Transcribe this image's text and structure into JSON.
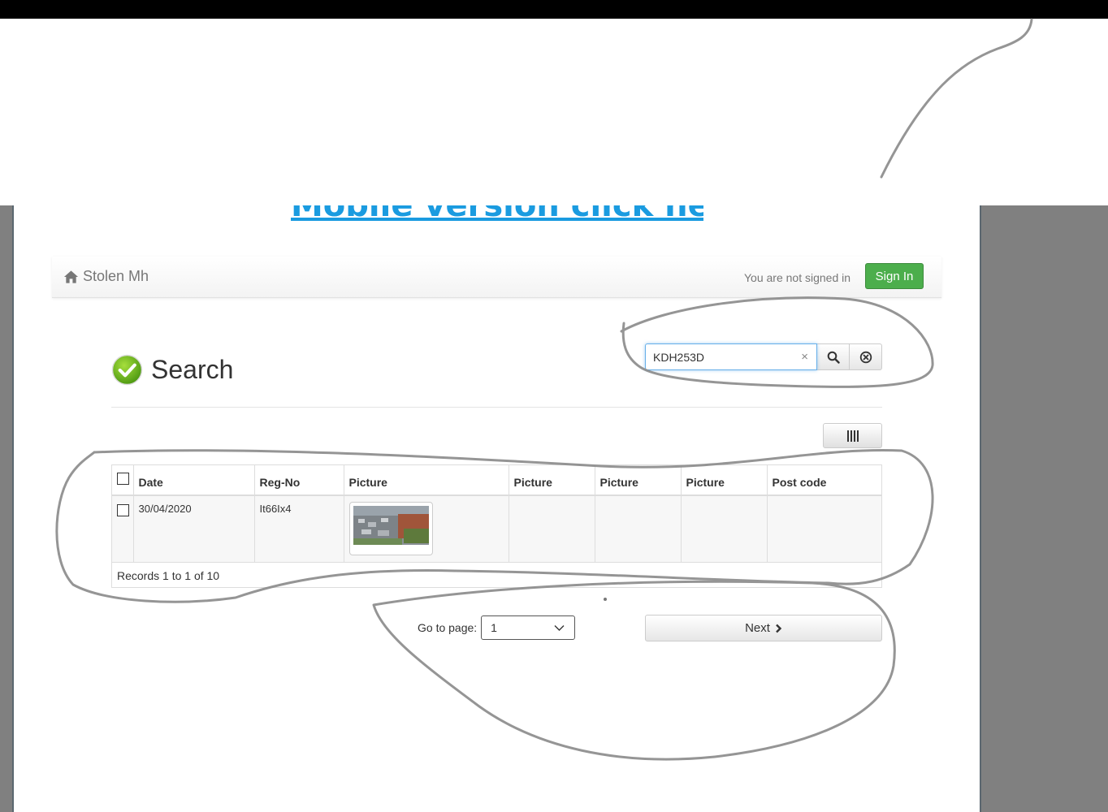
{
  "header": {
    "mobile_link": "Mobile version click here"
  },
  "navbar": {
    "brand": "Stolen Mh",
    "signed_status": "You are not signed in",
    "sign_in_label": "Sign In"
  },
  "page": {
    "title": "Search"
  },
  "search": {
    "value": "KDH253D",
    "clear_glyph": "×"
  },
  "grid": {
    "columns": [
      "Date",
      "Reg-No",
      "Picture",
      "Picture",
      "Picture",
      "Picture",
      "Post code"
    ],
    "rows": [
      {
        "date": "30/04/2020",
        "reg_no": "It66Ix4"
      }
    ],
    "footer": "Records 1 to 1 of 10"
  },
  "pager": {
    "goto_label": "Go to page:",
    "selected_page": "1",
    "next_label": "Next"
  },
  "colors": {
    "accent_green": "#4cae4c",
    "link_blue": "#1a9be0",
    "focus_blue": "#66afe9"
  },
  "icons": [
    "home-icon",
    "checkmark-circle-icon",
    "search-icon",
    "reset-circle-x-icon",
    "columns-icon",
    "chevron-down-icon",
    "chevron-right-icon"
  ]
}
